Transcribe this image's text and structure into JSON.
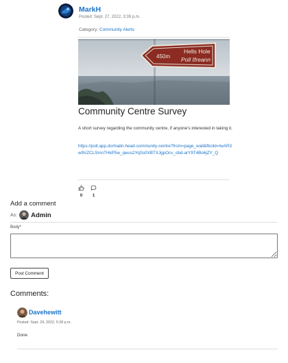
{
  "post": {
    "author": "MarkH",
    "posted": "Posted: Sept. 27, 2022, 3:39 p.m.",
    "category_prefix": "Category:",
    "category": "Community Alerts",
    "image_sign_distance": "450m",
    "image_sign_line1": "Hells Hole",
    "image_sign_line2": "Poll Ifreann",
    "title": "Community Centre Survey",
    "description": "A short survey regarding the community centre, if anyone's interested in taking it.",
    "link": "https://poll.app.do/malin-head-community-centre?from=page_wall&fbclid=IwAR3w9VZCLSmnTHkP5w_qwus2YqSs0XBTXJgpOcv_obd-arY9T4Bo6jZY_Q",
    "likes": "0",
    "comments_count": "1"
  },
  "form": {
    "heading": "Add a comment",
    "as_label": "As:",
    "user": "Admin",
    "body_label": "Body*",
    "body_value": "",
    "submit_label": "Post Comment"
  },
  "comments": {
    "heading": "Comments:",
    "items": [
      {
        "author": "Davehewitt",
        "posted": "Posted: Sept. 29, 2022, 5:28 p.m.",
        "body": "Done"
      }
    ]
  },
  "colors": {
    "link": "#1a73c9",
    "sign": "#8b2b22"
  },
  "icons": {
    "like": "thumbs-up-icon",
    "comment": "speech-bubble-icon"
  }
}
